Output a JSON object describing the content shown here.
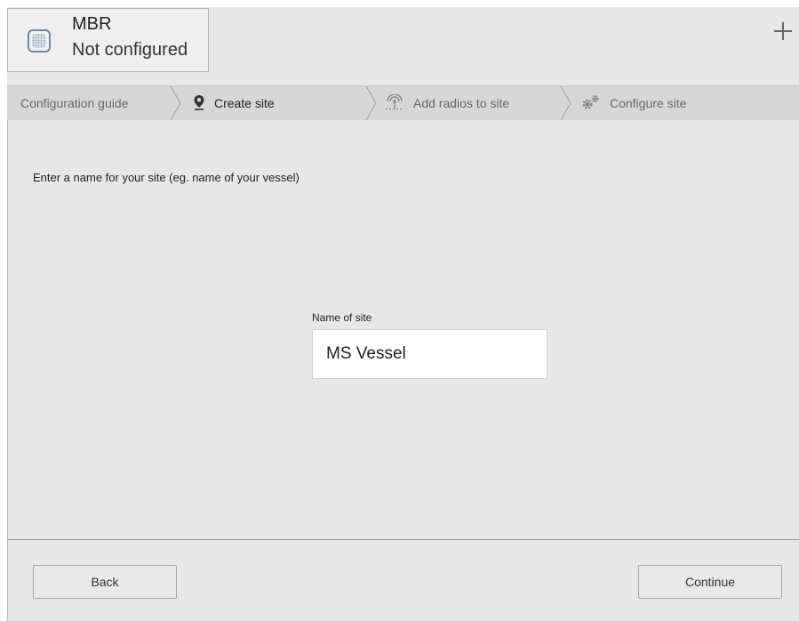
{
  "device": {
    "name": "MBR",
    "status": "Not configured"
  },
  "steps": [
    {
      "label": "Configuration guide",
      "icon": "none",
      "state": "done"
    },
    {
      "label": "Create site",
      "icon": "location-pin-icon",
      "state": "active"
    },
    {
      "label": "Add radios to site",
      "icon": "radio-antenna-icon",
      "state": "upcoming"
    },
    {
      "label": "Configure site",
      "icon": "gears-icon",
      "state": "upcoming"
    }
  ],
  "main": {
    "instruction": "Enter a name for your site (eg. name of your vessel)",
    "field_label": "Name of site",
    "site_name_value": "MS Vessel"
  },
  "footer": {
    "back_label": "Back",
    "continue_label": "Continue"
  },
  "colors": {
    "background": "#e7e7e7",
    "steps_bar": "#d7d7d7",
    "input_bg": "#ffffff"
  }
}
